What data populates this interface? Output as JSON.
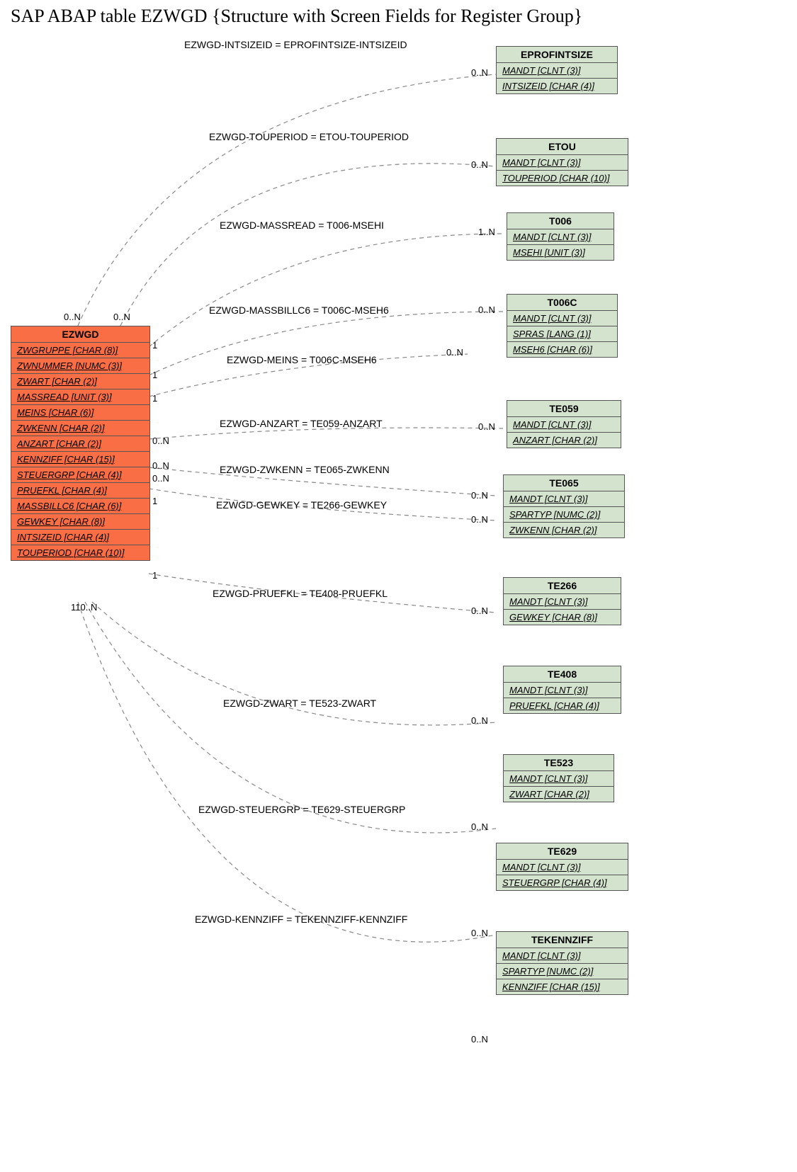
{
  "title": "SAP ABAP table EZWGD {Structure with Screen Fields for Register Group}",
  "main": {
    "name": "EZWGD",
    "fields": [
      "ZWGRUPPE [CHAR (8)]",
      "ZWNUMMER [NUMC (3)]",
      "ZWART [CHAR (2)]",
      "MASSREAD [UNIT (3)]",
      "MEINS [CHAR (6)]",
      "ZWKENN [CHAR (2)]",
      "ANZART [CHAR (2)]",
      "KENNZIFF [CHAR (15)]",
      "STEUERGRP [CHAR (4)]",
      "PRUEFKL [CHAR (4)]",
      "MASSBILLC6 [CHAR (6)]",
      "GEWKEY [CHAR (8)]",
      "INTSIZEID [CHAR (4)]",
      "TOUPERIOD [CHAR (10)]"
    ]
  },
  "rels": [
    {
      "label": "EZWGD-INTSIZEID = EPROFINTSIZE-INTSIZEID",
      "lcard": "0..N",
      "rcard": "0..N"
    },
    {
      "label": "EZWGD-TOUPERIOD = ETOU-TOUPERIOD",
      "lcard": "0..N",
      "rcard": "0..N"
    },
    {
      "label": "EZWGD-MASSREAD = T006-MSEHI",
      "lcard": "1",
      "rcard": "1..N"
    },
    {
      "label": "EZWGD-MASSBILLC6 = T006C-MSEH6",
      "lcard": "1",
      "rcard": "0..N"
    },
    {
      "label": "EZWGD-MEINS = T006C-MSEH6",
      "lcard": "1",
      "rcard": "0..N"
    },
    {
      "label": "EZWGD-ANZART = TE059-ANZART",
      "lcard": "0..N",
      "rcard": "0..N"
    },
    {
      "label": "EZWGD-ZWKENN = TE065-ZWKENN",
      "lcard": "0..N",
      "rcard": "0..N"
    },
    {
      "label": "EZWGD-GEWKEY = TE266-GEWKEY",
      "lcard": "0..N",
      "rcard": "0..N"
    },
    {
      "label": "EZWGD-PRUEFKL = TE408-PRUEFKL",
      "lcard": "1",
      "rcard": "0..N"
    },
    {
      "label": "EZWGD-ZWART = TE523-ZWART",
      "lcard": "1",
      "rcard": "0..N"
    },
    {
      "label": "EZWGD-STEUERGRP = TE629-STEUERGRP",
      "lcard": "1",
      "rcard": "0..N"
    },
    {
      "label": "EZWGD-KENNZIFF = TEKENNZIFF-KENNZIFF",
      "lcard": "0..N",
      "rcard": "0..N"
    }
  ],
  "mainBottomCard": "110..N",
  "targets": [
    {
      "name": "EPROFINTSIZE",
      "fields": [
        "MANDT [CLNT (3)]",
        "INTSIZEID [CHAR (4)]"
      ]
    },
    {
      "name": "ETOU",
      "fields": [
        "MANDT [CLNT (3)]",
        "TOUPERIOD [CHAR (10)]"
      ]
    },
    {
      "name": "T006",
      "fields": [
        "MANDT [CLNT (3)]",
        "MSEHI [UNIT (3)]"
      ]
    },
    {
      "name": "T006C",
      "fields": [
        "MANDT [CLNT (3)]",
        "SPRAS [LANG (1)]",
        "MSEH6 [CHAR (6)]"
      ]
    },
    {
      "name": "TE059",
      "fields": [
        "MANDT [CLNT (3)]",
        "ANZART [CHAR (2)]"
      ]
    },
    {
      "name": "TE065",
      "fields": [
        "MANDT [CLNT (3)]",
        "SPARTYP [NUMC (2)]",
        "ZWKENN [CHAR (2)]"
      ]
    },
    {
      "name": "TE266",
      "fields": [
        "MANDT [CLNT (3)]",
        "GEWKEY [CHAR (8)]"
      ]
    },
    {
      "name": "TE408",
      "fields": [
        "MANDT [CLNT (3)]",
        "PRUEFKL [CHAR (4)]"
      ]
    },
    {
      "name": "TE523",
      "fields": [
        "MANDT [CLNT (3)]",
        "ZWART [CHAR (2)]"
      ]
    },
    {
      "name": "TE629",
      "fields": [
        "MANDT [CLNT (3)]",
        "STEUERGRP [CHAR (4)]"
      ]
    },
    {
      "name": "TEKENNZIFF",
      "fields": [
        "MANDT [CLNT (3)]",
        "SPARTYP [NUMC (2)]",
        "KENNZIFF [CHAR (15)]"
      ]
    }
  ]
}
